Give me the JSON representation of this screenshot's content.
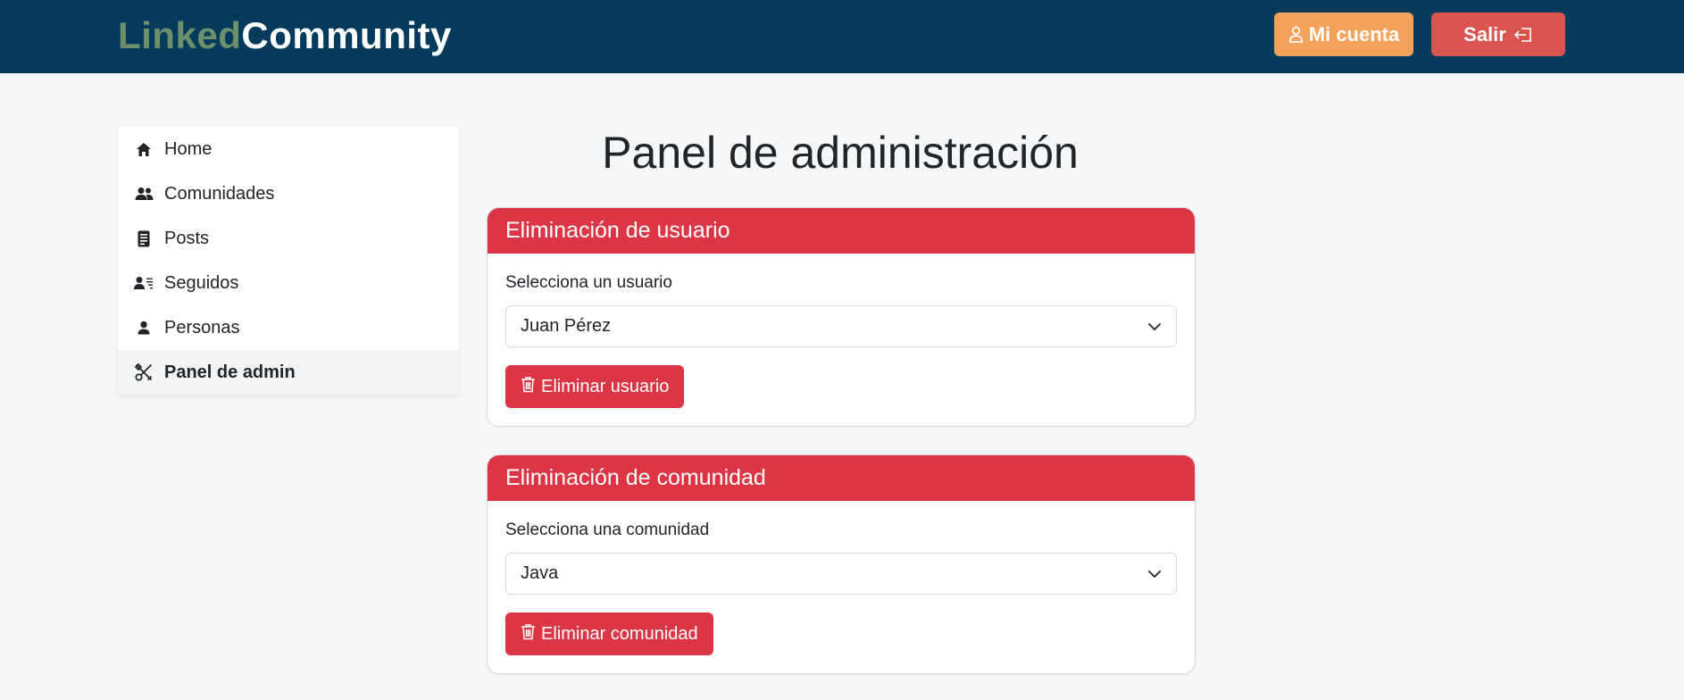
{
  "header": {
    "brand_part1": "Linked",
    "brand_part2": "Community",
    "account_label": "Mi cuenta",
    "logout_label": "Salir"
  },
  "sidebar": {
    "items": [
      {
        "label": "Home",
        "icon": "home-icon"
      },
      {
        "label": "Comunidades",
        "icon": "people-icon"
      },
      {
        "label": "Posts",
        "icon": "document-icon"
      },
      {
        "label": "Seguidos",
        "icon": "person-lines-icon"
      },
      {
        "label": "Personas",
        "icon": "person-icon"
      },
      {
        "label": "Panel de admin",
        "icon": "tools-icon",
        "active": true
      }
    ]
  },
  "main": {
    "title": "Panel de administración",
    "user_card": {
      "header": "Eliminación de usuario",
      "label": "Selecciona un usuario",
      "selected": "Juan Pérez",
      "button": "Eliminar usuario"
    },
    "community_card": {
      "header": "Eliminación de comunidad",
      "label": "Selecciona una comunidad",
      "selected": "Java",
      "button": "Eliminar comunidad"
    }
  },
  "colors": {
    "header_bg": "#043b5c",
    "brand_accent": "#6e8f6c",
    "account_button": "#f4a259",
    "logout_button": "#d9534f",
    "danger": "#dc3545"
  }
}
